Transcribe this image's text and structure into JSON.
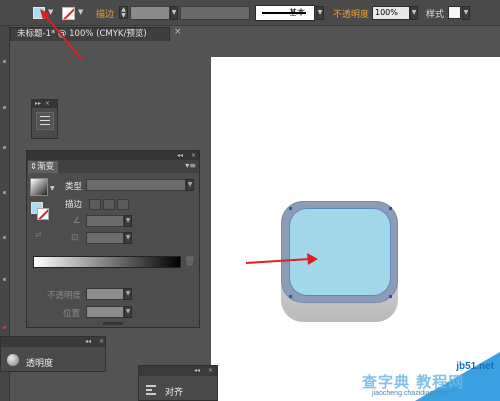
{
  "controlBar": {
    "strokeLabel": "描边",
    "brushName": "基本",
    "opacityLabel": "不透明度",
    "opacityValue": "100%",
    "styleLabel": "样式"
  },
  "document": {
    "tabTitle": "未标题-1* @ 100% (CMYK/预览)",
    "closeGlyph": "×"
  },
  "gradientPanel": {
    "title": "渐变",
    "typeLabel": "类型",
    "strokeLabel": "描边",
    "opacityLabel": "不透明度",
    "positionLabel": "位置"
  },
  "transparencyPanel": {
    "title": "透明度"
  },
  "alignPanel": {
    "title": "对齐"
  },
  "watermark": {
    "site": "jb51.net",
    "line1": "查字典 教程网",
    "line2": "jiaocheng.chazidian.com"
  },
  "colors": {
    "fill": "#a3d8ea",
    "accentOrange": "#f0a030",
    "arrow": "#e02020",
    "panelBg": "#4d4d4d",
    "workspace": "#535353"
  }
}
